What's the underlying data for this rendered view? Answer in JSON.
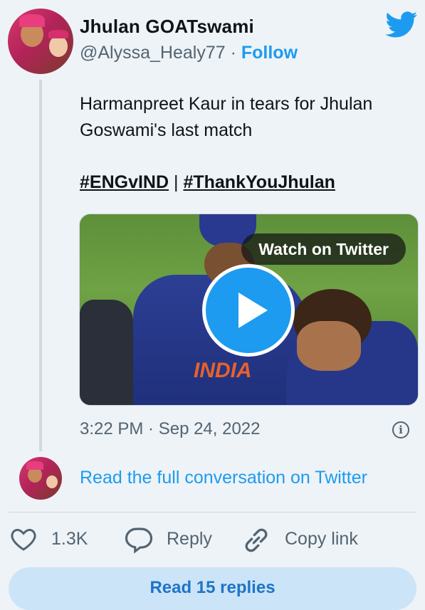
{
  "tweet": {
    "display_name": "Jhulan GOATswami",
    "handle": "@Alyssa_Healy77",
    "separator": " · ",
    "follow_label": "Follow",
    "text": "Harmanpreet Kaur in tears for Jhulan Goswami's last match",
    "hashtags": [
      "#ENGvIND",
      "#ThankYouJhulan"
    ],
    "hashtag_separator": "|",
    "timestamp": "3:22 PM · Sep 24, 2022",
    "info_glyph": "i"
  },
  "media": {
    "watch_label": "Watch on Twitter",
    "play_icon": "play-icon",
    "jersey_text": "INDIA"
  },
  "conversation": {
    "link_text": "Read the full conversation on Twitter"
  },
  "actions": {
    "like_count": "1.3K",
    "reply_label": "Reply",
    "copy_label": "Copy link"
  },
  "footer": {
    "read_replies_label": "Read 15 replies"
  },
  "colors": {
    "accent": "#1d9bf0",
    "background": "#eef3f7",
    "secondary_text": "#536471"
  }
}
